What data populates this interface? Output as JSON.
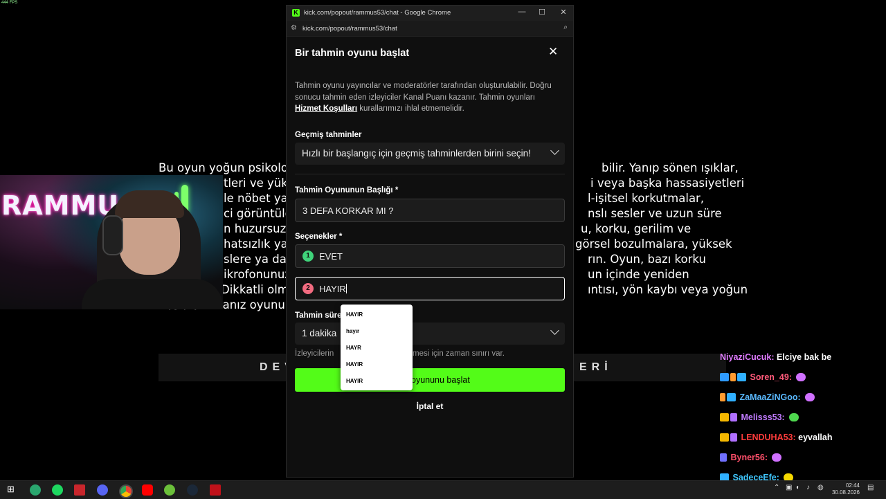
{
  "fps": "444 FPS",
  "game": {
    "lines": [
      {
        "l": "Bu oyun yoğun psikolo",
        "r": "bilir. Yanıp sönen ışıklar,"
      },
      {
        "l": "tleri ve yük",
        "r": "i veya başka hassasiyetleri"
      },
      {
        "l": "le nöbet ya",
        "r": "l-işitsel korkutmalar,"
      },
      {
        "l": "ci görüntüle",
        "r": "nslı sesler ve uzun süre"
      },
      {
        "l": "n huzursuz e",
        "r": "u, korku, gerilim ve"
      },
      {
        "l": "hatsızlık ya",
        "r": "görsel bozulmalara, yüksek"
      },
      {
        "l": "slere ya da",
        "r": "rın. Oyun, bazı korku"
      },
      {
        "l": "ikrofonunuz",
        "r": "un içinde yeniden"
      },
      {
        "l": "Dikkatli olm",
        "r": "ıntısı, yön kaybı veya yoğun"
      },
      {
        "l": "kaygı yaşa",
        "r": ""
      }
    ],
    "last_line_mid": "sanız oyunu",
    "bar_left": "DEV",
    "bar_right": "ERİ"
  },
  "webcam": {
    "sign": "RAMMU"
  },
  "browser": {
    "title": "kick.com/popout/rammus53/chat - Google Chrome",
    "url": "kick.com/popout/rammus53/chat",
    "minimize": "—",
    "maximize": "☐",
    "close": "✕"
  },
  "modal": {
    "title": "Bir tahmin oyunu başlat",
    "close": "✕",
    "desc_1": "Tahmin oyunu yayıncılar ve moderatörler tarafından oluşturulabilir. Doğru sonucu tahmin eden izleyiciler Kanal Puanı kazanır. Tahmin oyunları ",
    "desc_link": "Hizmet Koşulları",
    "desc_2": " kurallarımızı ihlal etmemelidir.",
    "past_label": "Geçmiş tahminler",
    "past_placeholder": "Hızlı bir başlangıç için geçmiş tahminlerden birini seçin!",
    "title_label": "Tahmin Oyununun Başlığı *",
    "title_value": "3 DEFA KORKAR MI ?",
    "options_label": "Seçenekler *",
    "options": [
      {
        "num": "1",
        "value": "EVET",
        "color": "#3fd37a"
      },
      {
        "num": "2",
        "value": "HAYIR",
        "color": "#f26b80"
      }
    ],
    "duration_label": "Tahmin süre",
    "duration_value": "1 dakika",
    "duration_hint_left": "İzleyicilerin",
    "duration_hint_right": "mesi için zaman sınırı var.",
    "start_button": "oyununu başlat",
    "cancel_button": "İptal et"
  },
  "autocomplete": [
    "HAYIR",
    "hayır",
    "HAYR",
    "HAYIR",
    "HAYIR"
  ],
  "chat": [
    {
      "user": "NiyaziCucuk:",
      "msg": "Elciye bak be",
      "color": "#e07bff"
    },
    {
      "user": "Soren_49:",
      "msg": "",
      "color": "#ff5a7a"
    },
    {
      "user": "ZaMaaZiNGoo:",
      "msg": "",
      "color": "#5ab9ff"
    },
    {
      "user": "Melisss53:",
      "msg": "",
      "color": "#c07bff"
    },
    {
      "user": "LENDUHA53:",
      "msg": "eyvallah",
      "color": "#ff3b3b"
    },
    {
      "user": "Byner56:",
      "msg": "",
      "color": "#ff4f6a"
    },
    {
      "user": "SadeceEfe:",
      "msg": "",
      "color": "#40c8ff"
    }
  ],
  "taskbar": {
    "time": "02:44",
    "date": "30.08.2026"
  }
}
